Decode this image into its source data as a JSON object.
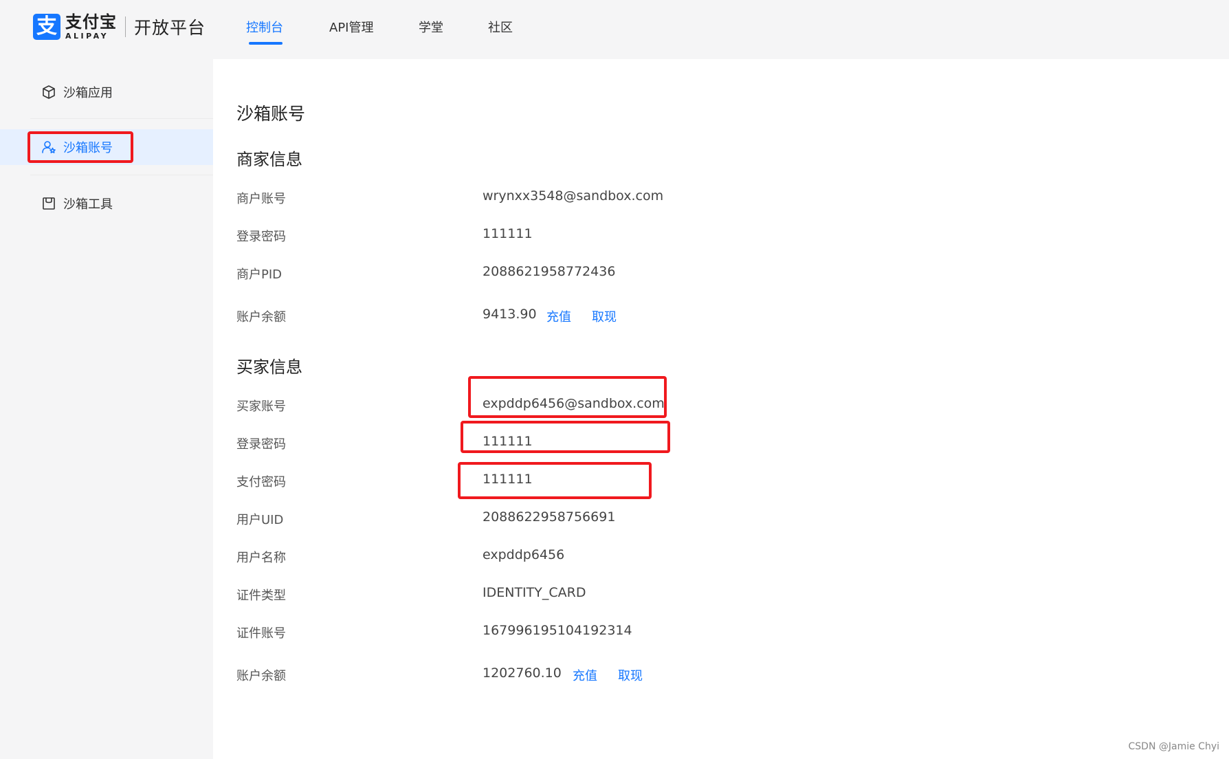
{
  "header": {
    "logo_mark": "支",
    "logo_cn": "支付宝",
    "logo_en": "ALIPAY",
    "logo_sub": "开放平台",
    "nav": [
      {
        "label": "控制台",
        "active": true
      },
      {
        "label": "API管理",
        "active": false
      },
      {
        "label": "学堂",
        "active": false
      },
      {
        "label": "社区",
        "active": false
      }
    ]
  },
  "sidebar": {
    "items": [
      {
        "label": "沙箱应用",
        "icon": "cube-icon",
        "active": false
      },
      {
        "label": "沙箱账号",
        "icon": "user-star-icon",
        "active": true
      },
      {
        "label": "沙箱工具",
        "icon": "bag-icon",
        "active": false
      }
    ]
  },
  "main": {
    "title": "沙箱账号",
    "merchant": {
      "title": "商家信息",
      "rows": [
        {
          "label": "商户账号",
          "value": "wrynxx3548@sandbox.com"
        },
        {
          "label": "登录密码",
          "value": "111111"
        },
        {
          "label": "商户PID",
          "value": "2088621958772436"
        },
        {
          "label": "账户余额",
          "value": "9413.90"
        }
      ],
      "recharge": "充值",
      "withdraw": "取现"
    },
    "buyer": {
      "title": "买家信息",
      "rows": [
        {
          "label": "买家账号",
          "value": "expddp6456@sandbox.com"
        },
        {
          "label": "登录密码",
          "value": "111111"
        },
        {
          "label": "支付密码",
          "value": "111111"
        },
        {
          "label": "用户UID",
          "value": "2088622958756691"
        },
        {
          "label": "用户名称",
          "value": "expddp6456"
        },
        {
          "label": "证件类型",
          "value": "IDENTITY_CARD"
        },
        {
          "label": "证件账号",
          "value": "167996195104192314"
        },
        {
          "label": "账户余额",
          "value": "1202760.10"
        }
      ],
      "recharge": "充值",
      "withdraw": "取现"
    }
  },
  "watermark": "CSDN @Jamie Chyi",
  "colors": {
    "accent": "#1677ff",
    "annotation": "#f0191e"
  }
}
